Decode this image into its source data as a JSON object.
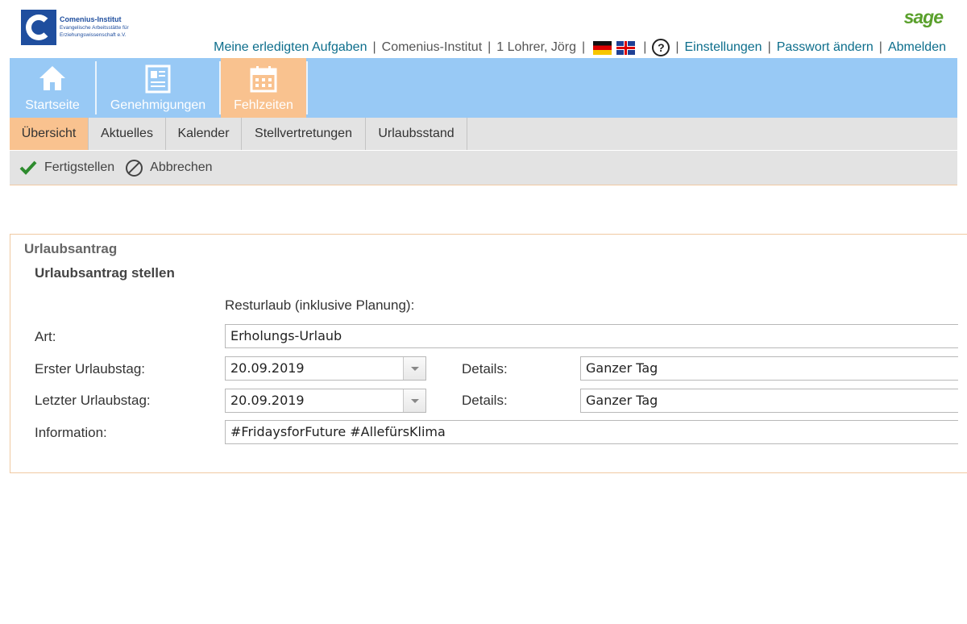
{
  "logo": {
    "name": "Comenius-Institut",
    "line2": "Evangelische Arbeitsstätte für",
    "line3": "Erziehungswissenschaft e.V."
  },
  "brand": "sage",
  "topnav": {
    "tasks": "Meine erledigten Aufgaben",
    "org": "Comenius-Institut",
    "user": "1 Lohrer, Jörg",
    "help": "?",
    "settings": "Einstellungen",
    "password": "Passwort ändern",
    "logout": "Abmelden",
    "separator": "|"
  },
  "modules": [
    {
      "label": "Startseite",
      "icon": "home-icon"
    },
    {
      "label": "Genehmigungen",
      "icon": "approvals-icon"
    },
    {
      "label": "Fehlzeiten",
      "icon": "calendar-icon",
      "active": true
    }
  ],
  "subtabs": [
    {
      "label": "Übersicht",
      "active": true
    },
    {
      "label": "Aktuelles"
    },
    {
      "label": "Kalender"
    },
    {
      "label": "Stellvertretungen"
    },
    {
      "label": "Urlaubsstand"
    }
  ],
  "toolbar": {
    "finish": "Fertigstellen",
    "cancel": "Abbrechen"
  },
  "form": {
    "title": "Urlaubsantrag",
    "subtitle": "Urlaubsantrag stellen",
    "remaining_label": "Resturlaub (inklusive Planung):",
    "art_label": "Art:",
    "art_value": "Erholungs-Urlaub",
    "first_day_label": "Erster Urlaubstag:",
    "first_day_value": "20.09.2019",
    "first_details_label": "Details:",
    "first_details_value": "Ganzer Tag",
    "last_day_label": "Letzter Urlaubstag:",
    "last_day_value": "20.09.2019",
    "last_details_label": "Details:",
    "last_details_value": "Ganzer Tag",
    "info_label": "Information:",
    "info_value": "#FridaysforFuture #AllefürsKlima"
  },
  "colors": {
    "module_bar": "#98c9f5",
    "active_tab": "#f9c28f",
    "link": "#0d6e8c",
    "sage_green": "#5aa02c",
    "logo_blue": "#1f4e9e"
  }
}
